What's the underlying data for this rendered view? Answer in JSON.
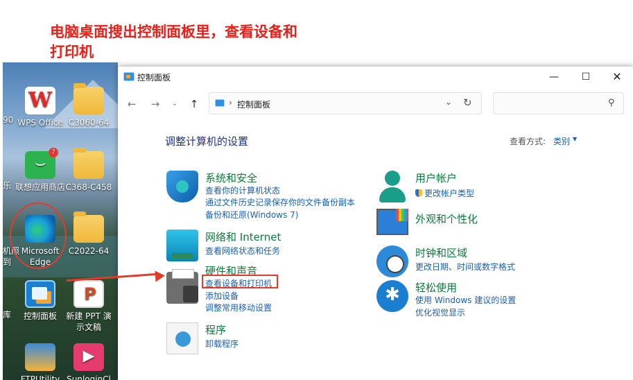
{
  "caption": {
    "line1": "电脑桌面搜出控制面板里，查看设备和",
    "line2": "打印机"
  },
  "desktop": {
    "icons": [
      {
        "label": "WPS Office"
      },
      {
        "label": "C3060-64"
      },
      {
        "label": "联想应用商店"
      },
      {
        "label": "C368-C458"
      },
      {
        "label": "Microsoft"
      },
      {
        "label": "Edge"
      },
      {
        "label": "C2022-64"
      },
      {
        "label": "控制面板"
      },
      {
        "label": "新建 PPT 演"
      },
      {
        "label": "示文稿"
      },
      {
        "label": "FTPUtility"
      },
      {
        "label": "SunloginCl"
      }
    ],
    "edge_fragments": [
      "90",
      "乐",
      "机照",
      "到",
      "库"
    ],
    "store_badge": "7"
  },
  "window": {
    "title": "控制面板",
    "controls": {
      "minimize": "—",
      "maximize": "☐",
      "close": "✕"
    },
    "nav": {
      "back": "←",
      "forward": "→",
      "recent": "⌄",
      "up": "↑"
    },
    "address": {
      "separator": "›",
      "crumb": "控制面板",
      "dropdown": "⌄",
      "refresh": "↻"
    },
    "search": {
      "placeholder": "",
      "icon": "⚲"
    },
    "heading": "调整计算机的设置",
    "view_by": {
      "label": "查看方式:",
      "value": "类别",
      "caret": "▼"
    },
    "left_categories": [
      {
        "title": "系统和安全",
        "icon": "shield-icon",
        "links": [
          "查看你的计算机状态",
          "通过文件历史记录保存你的文件备份副本",
          "备份和还原(Windows 7)"
        ]
      },
      {
        "title": "网络和 Internet",
        "icon": "network-icon",
        "links": [
          "查看网络状态和任务"
        ]
      },
      {
        "title": "硬件和声音",
        "icon": "printer-icon",
        "links": [
          "查看设备和打印机",
          "添加设备",
          "调整常用移动设置"
        ]
      },
      {
        "title": "程序",
        "icon": "programs-icon",
        "links": [
          "卸载程序"
        ]
      }
    ],
    "right_categories": [
      {
        "title": "用户帐户",
        "icon": "user-icon",
        "links": [
          "更改帐户类型"
        ]
      },
      {
        "title": "外观和个性化",
        "icon": "appearance-icon",
        "links": []
      },
      {
        "title": "时钟和区域",
        "icon": "clock-icon",
        "links": [
          "更改日期、时间或数字格式"
        ]
      },
      {
        "title": "轻松使用",
        "icon": "accessibility-icon",
        "links": [
          "使用 Windows 建议的设置",
          "优化视觉显示"
        ]
      }
    ]
  },
  "annotation_color": "#e23b2a",
  "caption_color": "#e8201a"
}
